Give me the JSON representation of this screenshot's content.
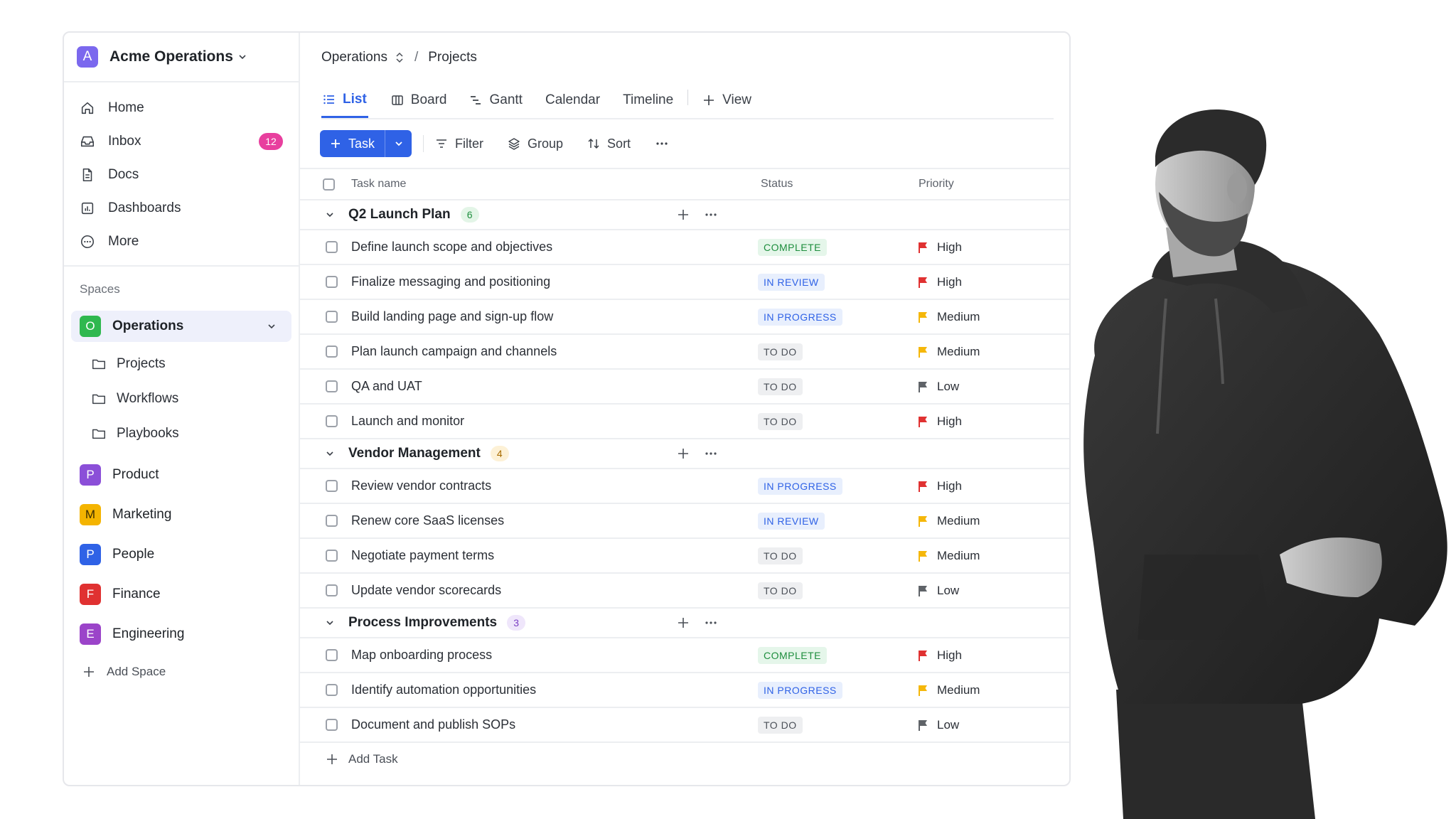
{
  "workspace": {
    "badge": "A",
    "name": "Acme Operations"
  },
  "nav": {
    "items": [
      {
        "label": "Home",
        "icon": "home-icon"
      },
      {
        "label": "Inbox",
        "icon": "inbox-icon",
        "badge": "12"
      },
      {
        "label": "Docs",
        "icon": "doc-icon"
      },
      {
        "label": "Dashboards",
        "icon": "dashboard-icon"
      },
      {
        "label": "More",
        "icon": "more-circle-icon"
      }
    ]
  },
  "spaces": {
    "label": "Spaces",
    "active": {
      "badge": "O",
      "name": "Operations",
      "color": "#2fb84f"
    },
    "folders": [
      "Projects",
      "Workflows",
      "Playbooks"
    ],
    "others": [
      {
        "badge": "P",
        "name": "Product",
        "color": "#8b4fd8"
      },
      {
        "badge": "M",
        "name": "Marketing",
        "color": "#f4b400"
      },
      {
        "badge": "P",
        "name": "People",
        "color": "#2f62e6"
      },
      {
        "badge": "F",
        "name": "Finance",
        "color": "#e03131"
      },
      {
        "badge": "E",
        "name": "Engineering",
        "color": "#9b44c9"
      }
    ],
    "add_label": "Add Space"
  },
  "breadcrumb": {
    "space": "Operations",
    "separator": "/",
    "page": "Projects"
  },
  "tabs": [
    "List",
    "Board",
    "Gantt",
    "Calendar",
    "Timeline"
  ],
  "add_view_label": "View",
  "toolbar": {
    "task_label": "Task",
    "filter": "Filter",
    "group": "Group",
    "sort": "Sort"
  },
  "columns": {
    "name": "Task name",
    "status": "Status",
    "priority": "Priority"
  },
  "groups": [
    {
      "name": "Q2 Launch Plan",
      "count": "6",
      "count_bg": "#e3f5e7",
      "count_fg": "#1e8e3e",
      "tasks": [
        {
          "name": "Define launch scope and objectives",
          "status": "COMPLETE",
          "priority": "High"
        },
        {
          "name": "Finalize messaging and positioning",
          "status": "IN REVIEW",
          "priority": "High"
        },
        {
          "name": "Build landing page and sign-up flow",
          "status": "IN PROGRESS",
          "priority": "Medium"
        },
        {
          "name": "Plan launch campaign and channels",
          "status": "TO DO",
          "priority": "Medium"
        },
        {
          "name": "QA and UAT",
          "status": "TO DO",
          "priority": "Low"
        },
        {
          "name": "Launch and monitor",
          "status": "TO DO",
          "priority": "High"
        }
      ]
    },
    {
      "name": "Vendor Management",
      "count": "4",
      "count_bg": "#fdf1d6",
      "count_fg": "#a86b00",
      "tasks": [
        {
          "name": "Review vendor contracts",
          "status": "IN PROGRESS",
          "priority": "High"
        },
        {
          "name": "Renew core SaaS licenses",
          "status": "IN REVIEW",
          "priority": "Medium"
        },
        {
          "name": "Negotiate payment terms",
          "status": "TO DO",
          "priority": "Medium"
        },
        {
          "name": "Update vendor scorecards",
          "status": "TO DO",
          "priority": "Low"
        }
      ]
    },
    {
      "name": "Process Improvements",
      "count": "3",
      "count_bg": "#efe6fb",
      "count_fg": "#7b3fc4",
      "tasks": [
        {
          "name": "Map onboarding process",
          "status": "COMPLETE",
          "priority": "High"
        },
        {
          "name": "Identify automation opportunities",
          "status": "IN PROGRESS",
          "priority": "Medium"
        },
        {
          "name": "Document and publish SOPs",
          "status": "TO DO",
          "priority": "Low"
        }
      ]
    }
  ],
  "add_task_label": "Add Task",
  "priority_colors": {
    "High": "#e03131",
    "Medium": "#f5b70a",
    "Low": "#5f6368"
  },
  "accent": "#2f62e6"
}
